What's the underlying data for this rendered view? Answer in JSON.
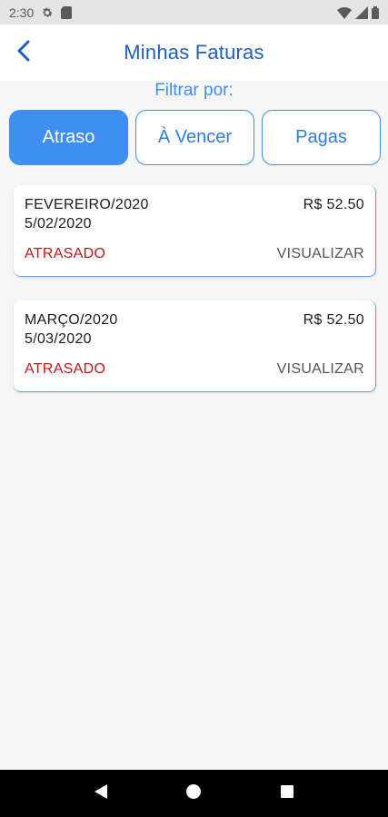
{
  "status_bar": {
    "time": "2:30",
    "icons": [
      "settings-icon",
      "sd-card-icon",
      "wifi-icon",
      "signal-icon",
      "battery-icon"
    ]
  },
  "app_bar": {
    "title": "Minhas Faturas",
    "back_icon": "chevron-left-icon"
  },
  "filter": {
    "label": "Filtrar por:",
    "options": [
      {
        "label": "Atraso",
        "active": true
      },
      {
        "label": "À Vencer",
        "active": false
      },
      {
        "label": "Pagas",
        "active": false
      }
    ]
  },
  "invoices": [
    {
      "month": "FEVEREIRO/2020",
      "date": "5/02/2020",
      "amount": "R$ 52.50",
      "status": "ATRASADO",
      "action": "VISUALIZAR"
    },
    {
      "month": "MARÇO/2020",
      "date": "5/03/2020",
      "amount": "R$ 52.50",
      "status": "ATRASADO",
      "action": "VISUALIZAR"
    }
  ],
  "nav_bar": {
    "icons": [
      "back-triangle-icon",
      "home-circle-icon",
      "recents-square-icon"
    ]
  },
  "colors": {
    "primary": "#3f8ff0",
    "title": "#1f5fbf",
    "overdue": "#c0171a"
  }
}
